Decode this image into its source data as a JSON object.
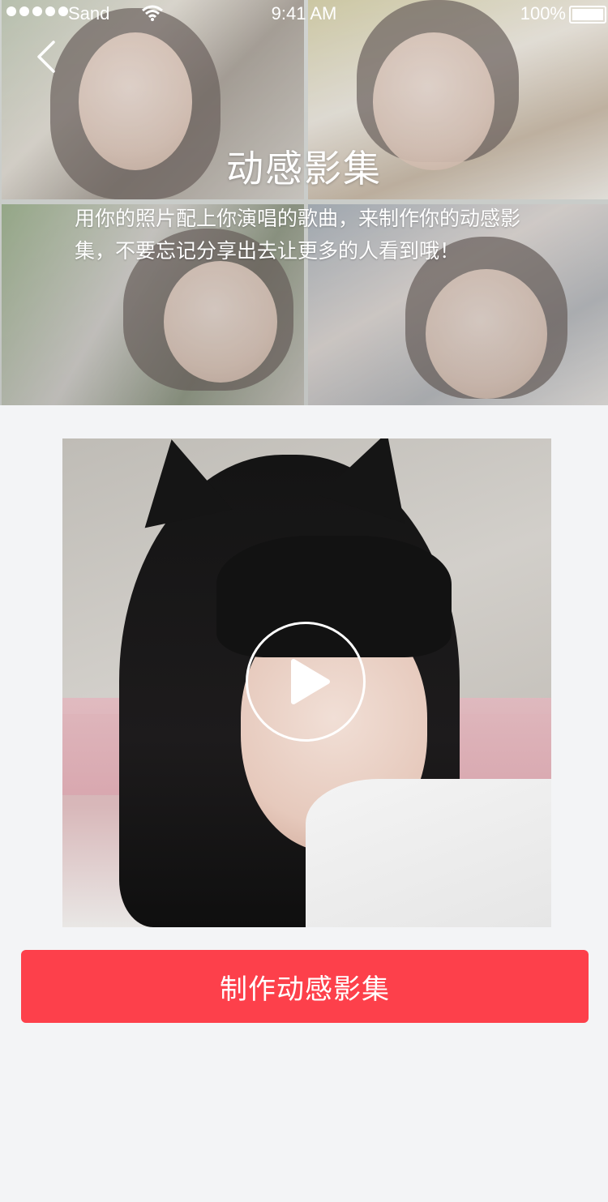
{
  "status_bar": {
    "carrier": "Sand",
    "time": "9:41 AM",
    "battery": "100%"
  },
  "header": {
    "title": "动感影集",
    "description": "用你的照片配上你演唱的歌曲，来制作你的动感影集，不要忘记分享出去让更多的人看到哦！"
  },
  "icons": {
    "back": "chevron-left-icon",
    "play": "play-icon",
    "wifi": "wifi-icon",
    "battery": "battery-icon"
  },
  "actions": {
    "make_album_label": "制作动感影集"
  },
  "colors": {
    "accent": "#fd404b",
    "background": "#f3f4f6",
    "text_on_accent": "#ffffff"
  }
}
